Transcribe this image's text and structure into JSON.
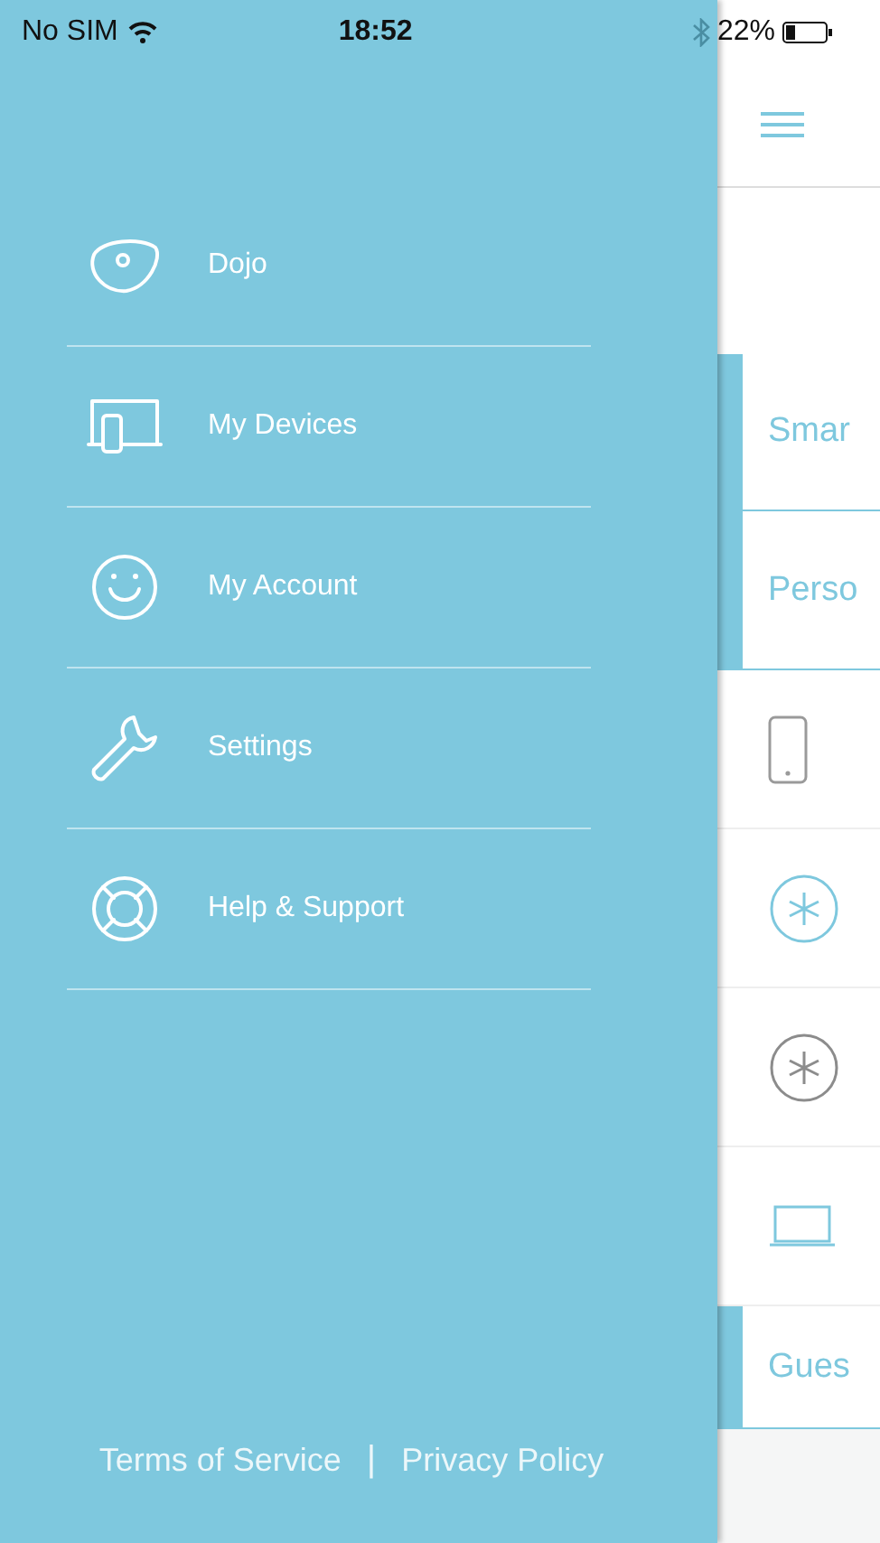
{
  "status_bar": {
    "carrier": "No SIM",
    "time": "18:52",
    "battery": "22%"
  },
  "drawer": {
    "items": [
      {
        "kind": "dojo",
        "label": "Dojo"
      },
      {
        "kind": "devices",
        "label": "My Devices"
      },
      {
        "kind": "account",
        "label": "My Account"
      },
      {
        "kind": "settings",
        "label": "Settings"
      },
      {
        "kind": "help",
        "label": "Help & Support"
      }
    ],
    "footer": {
      "links": [
        "Terms of Service",
        "Privacy Policy"
      ],
      "separator": "|"
    }
  },
  "main": {
    "sections": [
      {
        "kind": "header",
        "label": "Smar"
      },
      {
        "kind": "header",
        "label": "Perso"
      },
      {
        "kind": "phone",
        "color": "#9a9a9a"
      },
      {
        "kind": "star",
        "color": "#7ec8de"
      },
      {
        "kind": "star",
        "color": "#8c8c8c"
      },
      {
        "kind": "laptop",
        "color": "#7ec8de"
      },
      {
        "kind": "header",
        "label": "Gues"
      }
    ]
  }
}
